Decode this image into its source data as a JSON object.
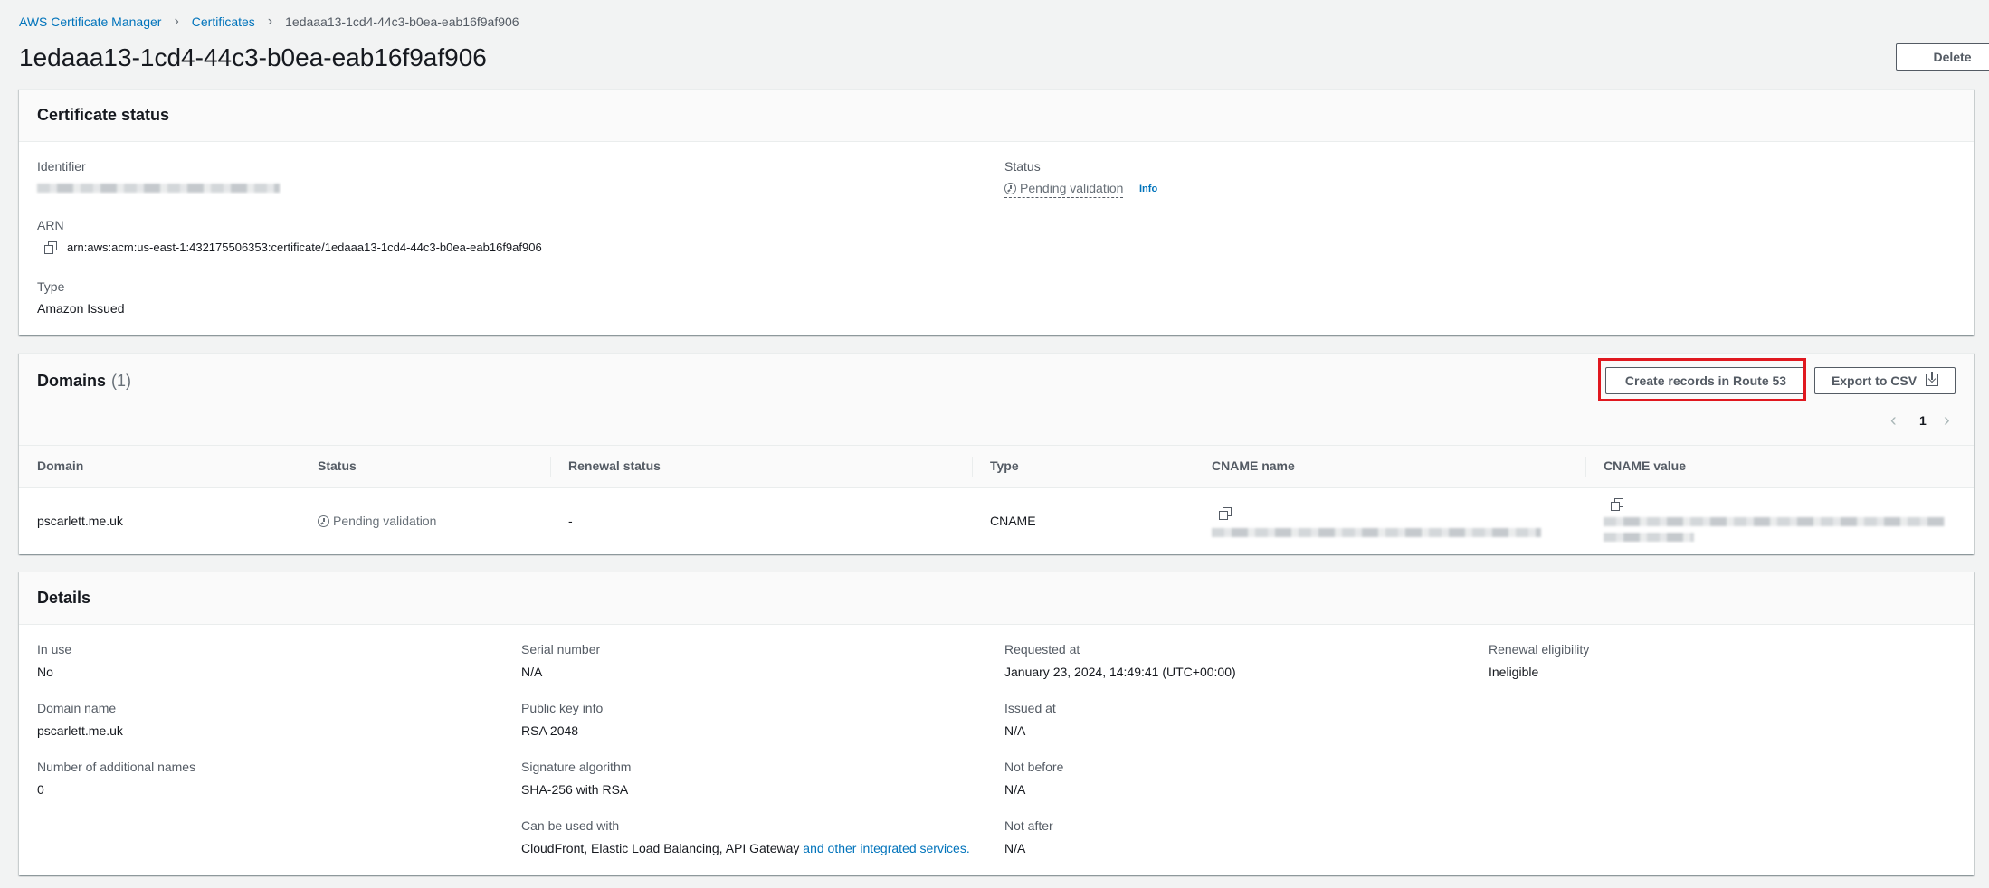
{
  "breadcrumb": {
    "items": [
      "AWS Certificate Manager",
      "Certificates"
    ],
    "current": "1edaaa13-1cd4-44c3-b0ea-eab16f9af906",
    "separator_icon": "chevron-right-icon"
  },
  "page_title": "1edaaa13-1cd4-44c3-b0ea-eab16f9af906",
  "delete_label": "Delete",
  "certificate_status": {
    "title": "Certificate status",
    "identifier_label": "Identifier",
    "status_label": "Status",
    "status_value": "Pending validation",
    "info_link": "Info",
    "arn_label": "ARN",
    "arn_value": "arn:aws:acm:us-east-1:432175506353:certificate/1edaaa13-1cd4-44c3-b0ea-eab16f9af906",
    "type_label": "Type",
    "type_value": "Amazon Issued"
  },
  "domains": {
    "title": "Domains",
    "count": "(1)",
    "create_records_label": "Create records in Route 53",
    "export_label": "Export to CSV",
    "page_number": "1",
    "columns": [
      "Domain",
      "Status",
      "Renewal status",
      "Type",
      "CNAME name",
      "CNAME value"
    ],
    "rows": [
      {
        "domain": "pscarlett.me.uk",
        "status": "Pending validation",
        "renewal_status": "-",
        "type": "CNAME"
      }
    ]
  },
  "details": {
    "title": "Details",
    "in_use_label": "In use",
    "in_use_value": "No",
    "domain_name_label": "Domain name",
    "domain_name_value": "pscarlett.me.uk",
    "additional_names_label": "Number of additional names",
    "additional_names_value": "0",
    "serial_label": "Serial number",
    "serial_value": "N/A",
    "public_key_label": "Public key info",
    "public_key_value": "RSA 2048",
    "sig_alg_label": "Signature algorithm",
    "sig_alg_value": "SHA-256 with RSA",
    "used_with_label": "Can be used with",
    "used_with_value": "CloudFront, Elastic Load Balancing, API Gateway",
    "used_with_link": "and other integrated services.",
    "requested_label": "Requested at",
    "requested_value": "January 23, 2024, 14:49:41 (UTC+00:00)",
    "issued_label": "Issued at",
    "issued_value": "N/A",
    "not_before_label": "Not before",
    "not_before_value": "N/A",
    "not_after_label": "Not after",
    "not_after_value": "N/A",
    "renewal_label": "Renewal eligibility",
    "renewal_value": "Ineligible"
  },
  "colors": {
    "link": "#0073bb",
    "highlight": "#e0181f",
    "background": "#f2f3f3"
  }
}
